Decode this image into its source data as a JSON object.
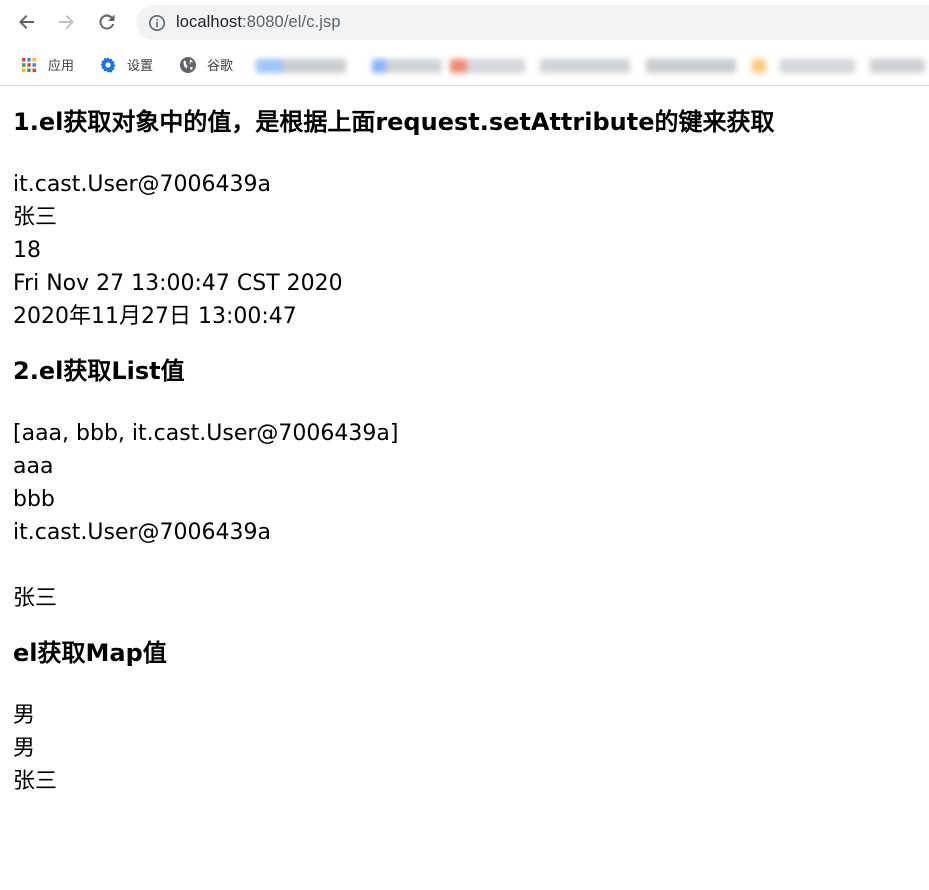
{
  "browser": {
    "url_host": "localhost",
    "url_path": ":8080/el/c.jsp"
  },
  "bookmarks": {
    "apps": "应用",
    "settings": "设置",
    "google": "谷歌"
  },
  "section1": {
    "heading": "1.el获取对象中的值，是根据上面request.setAttribute的键来获取",
    "lines": [
      "it.cast.User@7006439a",
      "张三",
      "18",
      "Fri Nov 27 13:00:47 CST 2020",
      "2020年11月27日 13:00:47"
    ]
  },
  "section2": {
    "heading": "2.el获取List值",
    "lines": [
      "[aaa, bbb, it.cast.User@7006439a]",
      "aaa",
      "bbb",
      "it.cast.User@7006439a",
      "",
      "张三"
    ]
  },
  "section3": {
    "heading": "el获取Map值",
    "lines": [
      "男",
      "男",
      "张三"
    ]
  },
  "colors": {
    "omnibox_bg": "#f1f3f4",
    "icon_gray": "#5f6368",
    "settings_blue": "#1a73e8"
  }
}
